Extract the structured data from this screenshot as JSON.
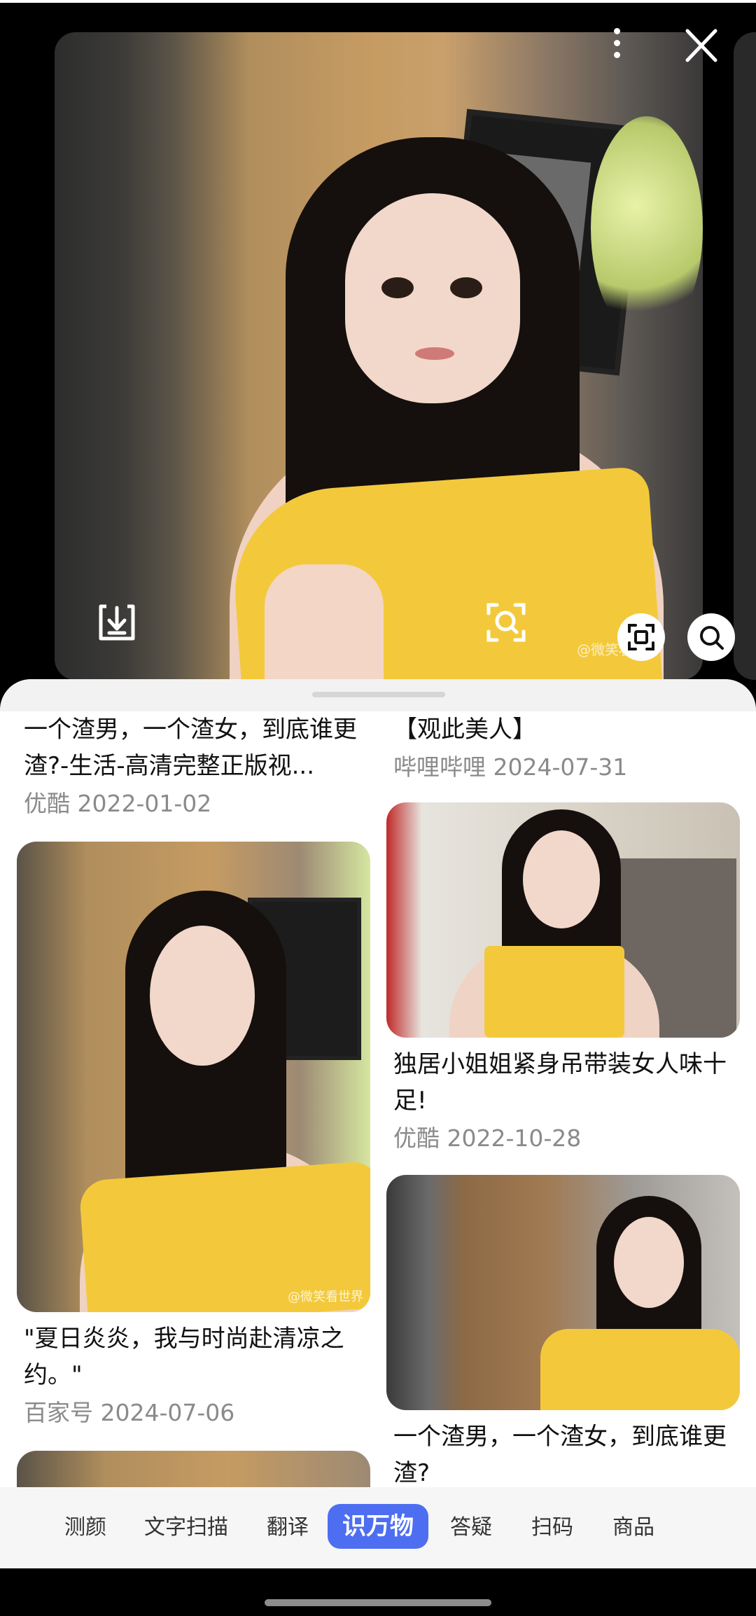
{
  "preview": {
    "watermark": "@微笑看世界",
    "menu_icon": "more-vertical-icon",
    "close_icon": "close-icon"
  },
  "results": {
    "left": [
      {
        "title": "一个渣男，一个渣女，到底谁更渣?-生活-高清完整正版视...",
        "source": "优酷",
        "date": "2022-01-02"
      },
      {
        "title": "\"夏日炎炎，我与时尚赴清凉之约。\"",
        "source": "百家号",
        "date": "2024-07-06",
        "watermark": "@微笑看世界"
      }
    ],
    "right": [
      {
        "title": "【观此美人】",
        "source": "哔哩哔哩",
        "date": "2024-07-31"
      },
      {
        "title": "独居小姐姐紧身吊带装女人味十足!",
        "source": "优酷",
        "date": "2022-10-28"
      },
      {
        "title": "一个渣男，一个渣女，到底谁更渣?",
        "source": "",
        "date": ""
      }
    ]
  },
  "tabs": [
    "测颜",
    "文字扫描",
    "翻译",
    "识万物",
    "答疑",
    "扫码",
    "商品"
  ],
  "active_tab": "识万物",
  "colors": {
    "accent": "#4e6ef2",
    "shirt": "#f3c93b"
  }
}
